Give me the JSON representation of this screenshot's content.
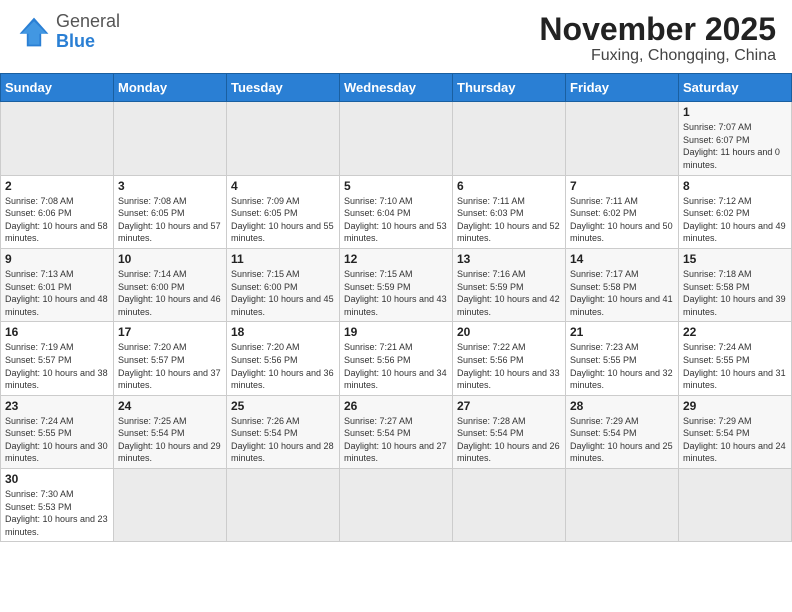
{
  "header": {
    "logo_general": "General",
    "logo_blue": "Blue",
    "title": "November 2025",
    "subtitle": "Fuxing, Chongqing, China"
  },
  "days_of_week": [
    "Sunday",
    "Monday",
    "Tuesday",
    "Wednesday",
    "Thursday",
    "Friday",
    "Saturday"
  ],
  "weeks": [
    [
      {
        "day": "",
        "info": ""
      },
      {
        "day": "",
        "info": ""
      },
      {
        "day": "",
        "info": ""
      },
      {
        "day": "",
        "info": ""
      },
      {
        "day": "",
        "info": ""
      },
      {
        "day": "",
        "info": ""
      },
      {
        "day": "1",
        "info": "Sunrise: 7:07 AM\nSunset: 6:07 PM\nDaylight: 11 hours and 0 minutes."
      }
    ],
    [
      {
        "day": "2",
        "info": "Sunrise: 7:08 AM\nSunset: 6:06 PM\nDaylight: 10 hours and 58 minutes."
      },
      {
        "day": "3",
        "info": "Sunrise: 7:08 AM\nSunset: 6:05 PM\nDaylight: 10 hours and 57 minutes."
      },
      {
        "day": "4",
        "info": "Sunrise: 7:09 AM\nSunset: 6:05 PM\nDaylight: 10 hours and 55 minutes."
      },
      {
        "day": "5",
        "info": "Sunrise: 7:10 AM\nSunset: 6:04 PM\nDaylight: 10 hours and 53 minutes."
      },
      {
        "day": "6",
        "info": "Sunrise: 7:11 AM\nSunset: 6:03 PM\nDaylight: 10 hours and 52 minutes."
      },
      {
        "day": "7",
        "info": "Sunrise: 7:11 AM\nSunset: 6:02 PM\nDaylight: 10 hours and 50 minutes."
      },
      {
        "day": "8",
        "info": "Sunrise: 7:12 AM\nSunset: 6:02 PM\nDaylight: 10 hours and 49 minutes."
      }
    ],
    [
      {
        "day": "9",
        "info": "Sunrise: 7:13 AM\nSunset: 6:01 PM\nDaylight: 10 hours and 48 minutes."
      },
      {
        "day": "10",
        "info": "Sunrise: 7:14 AM\nSunset: 6:00 PM\nDaylight: 10 hours and 46 minutes."
      },
      {
        "day": "11",
        "info": "Sunrise: 7:15 AM\nSunset: 6:00 PM\nDaylight: 10 hours and 45 minutes."
      },
      {
        "day": "12",
        "info": "Sunrise: 7:15 AM\nSunset: 5:59 PM\nDaylight: 10 hours and 43 minutes."
      },
      {
        "day": "13",
        "info": "Sunrise: 7:16 AM\nSunset: 5:59 PM\nDaylight: 10 hours and 42 minutes."
      },
      {
        "day": "14",
        "info": "Sunrise: 7:17 AM\nSunset: 5:58 PM\nDaylight: 10 hours and 41 minutes."
      },
      {
        "day": "15",
        "info": "Sunrise: 7:18 AM\nSunset: 5:58 PM\nDaylight: 10 hours and 39 minutes."
      }
    ],
    [
      {
        "day": "16",
        "info": "Sunrise: 7:19 AM\nSunset: 5:57 PM\nDaylight: 10 hours and 38 minutes."
      },
      {
        "day": "17",
        "info": "Sunrise: 7:20 AM\nSunset: 5:57 PM\nDaylight: 10 hours and 37 minutes."
      },
      {
        "day": "18",
        "info": "Sunrise: 7:20 AM\nSunset: 5:56 PM\nDaylight: 10 hours and 36 minutes."
      },
      {
        "day": "19",
        "info": "Sunrise: 7:21 AM\nSunset: 5:56 PM\nDaylight: 10 hours and 34 minutes."
      },
      {
        "day": "20",
        "info": "Sunrise: 7:22 AM\nSunset: 5:56 PM\nDaylight: 10 hours and 33 minutes."
      },
      {
        "day": "21",
        "info": "Sunrise: 7:23 AM\nSunset: 5:55 PM\nDaylight: 10 hours and 32 minutes."
      },
      {
        "day": "22",
        "info": "Sunrise: 7:24 AM\nSunset: 5:55 PM\nDaylight: 10 hours and 31 minutes."
      }
    ],
    [
      {
        "day": "23",
        "info": "Sunrise: 7:24 AM\nSunset: 5:55 PM\nDaylight: 10 hours and 30 minutes."
      },
      {
        "day": "24",
        "info": "Sunrise: 7:25 AM\nSunset: 5:54 PM\nDaylight: 10 hours and 29 minutes."
      },
      {
        "day": "25",
        "info": "Sunrise: 7:26 AM\nSunset: 5:54 PM\nDaylight: 10 hours and 28 minutes."
      },
      {
        "day": "26",
        "info": "Sunrise: 7:27 AM\nSunset: 5:54 PM\nDaylight: 10 hours and 27 minutes."
      },
      {
        "day": "27",
        "info": "Sunrise: 7:28 AM\nSunset: 5:54 PM\nDaylight: 10 hours and 26 minutes."
      },
      {
        "day": "28",
        "info": "Sunrise: 7:29 AM\nSunset: 5:54 PM\nDaylight: 10 hours and 25 minutes."
      },
      {
        "day": "29",
        "info": "Sunrise: 7:29 AM\nSunset: 5:54 PM\nDaylight: 10 hours and 24 minutes."
      }
    ],
    [
      {
        "day": "30",
        "info": "Sunrise: 7:30 AM\nSunset: 5:53 PM\nDaylight: 10 hours and 23 minutes."
      },
      {
        "day": "",
        "info": ""
      },
      {
        "day": "",
        "info": ""
      },
      {
        "day": "",
        "info": ""
      },
      {
        "day": "",
        "info": ""
      },
      {
        "day": "",
        "info": ""
      },
      {
        "day": "",
        "info": ""
      }
    ]
  ]
}
